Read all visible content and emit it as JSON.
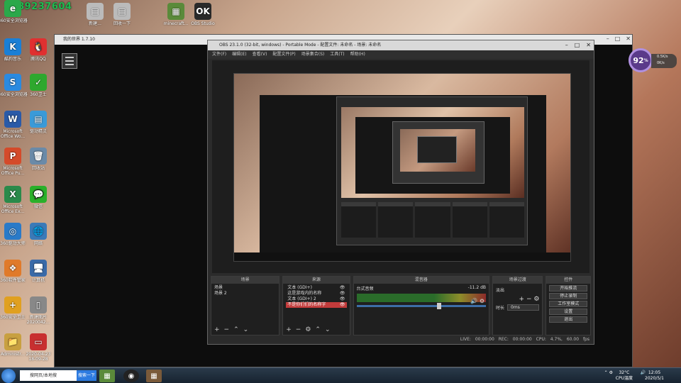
{
  "overlay": {
    "text": "2489237604"
  },
  "desktop_icons": [
    {
      "label": "酷狗音乐",
      "glyph": "K",
      "color": "#1a7fd6"
    },
    {
      "label": "腾讯QQ",
      "glyph": "🐧",
      "color": "#e03030"
    },
    {
      "label": "360安全浏览器",
      "glyph": "S",
      "color": "#2a8ae0"
    },
    {
      "label": "360卫士",
      "glyph": "✓",
      "color": "#2ea82e"
    },
    {
      "label": "Microsoft Office Wo...",
      "glyph": "W",
      "color": "#2a5aa8"
    },
    {
      "label": "驱动精灵",
      "glyph": "▤",
      "color": "#3a9ad8"
    },
    {
      "label": "Microsoft Office Pu...",
      "glyph": "P",
      "color": "#d44a2a"
    },
    {
      "label": "回收站",
      "glyph": "🗑",
      "color": "#6a8aa8"
    },
    {
      "label": "Microsoft Office Ex...",
      "glyph": "X",
      "color": "#2a8a4a"
    },
    {
      "label": "微信",
      "glyph": "💬",
      "color": "#2ab02a"
    },
    {
      "label": "360驱动大师",
      "glyph": "◎",
      "color": "#2a7ac8"
    },
    {
      "label": "网络",
      "glyph": "🌐",
      "color": "#3a7ab8"
    },
    {
      "label": "360软件管家",
      "glyph": "❖",
      "color": "#e07a2a"
    },
    {
      "label": "计算机",
      "glyph": "🖥",
      "color": "#3a6aa8"
    },
    {
      "label": "360安全卫士",
      "glyph": "+",
      "color": "#e0a020"
    },
    {
      "label": "新建图片 2020042...",
      "glyph": "▯",
      "color": "#888"
    },
    {
      "label": "Administr...",
      "glyph": "📁",
      "color": "#c8a040"
    },
    {
      "label": "2020-04-23 18-09-28",
      "glyph": "▭",
      "color": "#c83030"
    },
    {
      "label": "360安全浏览器",
      "glyph": "e",
      "color": "#2aa84a"
    }
  ],
  "top_icons": [
    {
      "label": "新建...",
      "glyph": "▤",
      "color": "#bbb"
    },
    {
      "label": "回收一下",
      "glyph": "▤",
      "color": "#bbb"
    },
    {
      "label": "minecraft...",
      "glyph": "▦",
      "color": "#5a8a3a"
    },
    {
      "label": "OBS Studio",
      "glyph": "OK",
      "color": "#2a2a2a"
    }
  ],
  "mc_window": {
    "title": "我的世界 1.7.10"
  },
  "obs": {
    "title": "OBS 23.1.0 (32-bit, windows) - Portable Mode - 配置文件: 未命名 - 场景: 未命名",
    "menu": [
      "文件(F)",
      "编辑(E)",
      "查看(V)",
      "配置文件(P)",
      "场景集合(S)",
      "工具(T)",
      "帮助(H)"
    ],
    "docks": {
      "scenes": {
        "title": "场景",
        "items": [
          "场景",
          "场景 2"
        ]
      },
      "sources": {
        "title": "来源",
        "items": [
          "文本 (GDI+)",
          "这是游戏内的名称",
          "文本 (GDI+) 2",
          "不是你们们的名称字"
        ]
      },
      "mixer": {
        "title": "混音器",
        "track_name": "台式音频",
        "db": "-11.2 dB"
      },
      "transitions": {
        "title": "场景过渡",
        "type": "淡出",
        "duration_label": "时长",
        "duration": "0ms"
      },
      "controls": {
        "title": "控件",
        "buttons": [
          "开始推流",
          "停止录制",
          "工作室模式",
          "设置",
          "退出"
        ]
      }
    },
    "status": {
      "live": "LIVE: 00:00:00",
      "rec": "REC: 00:00:00",
      "cpu": "CPU: 4.7%, 60.00 fps"
    }
  },
  "gauge": {
    "value": "92",
    "unit": "%",
    "net_up": "0.5K/s",
    "net_down": "0K/s"
  },
  "taskbar": {
    "search_placeholder": "搜网页/本地搜",
    "search_button": "搜索一下",
    "temp": "32°C",
    "cpu_label": "CPU温度",
    "time": "12:05",
    "date": "2020/5/1"
  }
}
